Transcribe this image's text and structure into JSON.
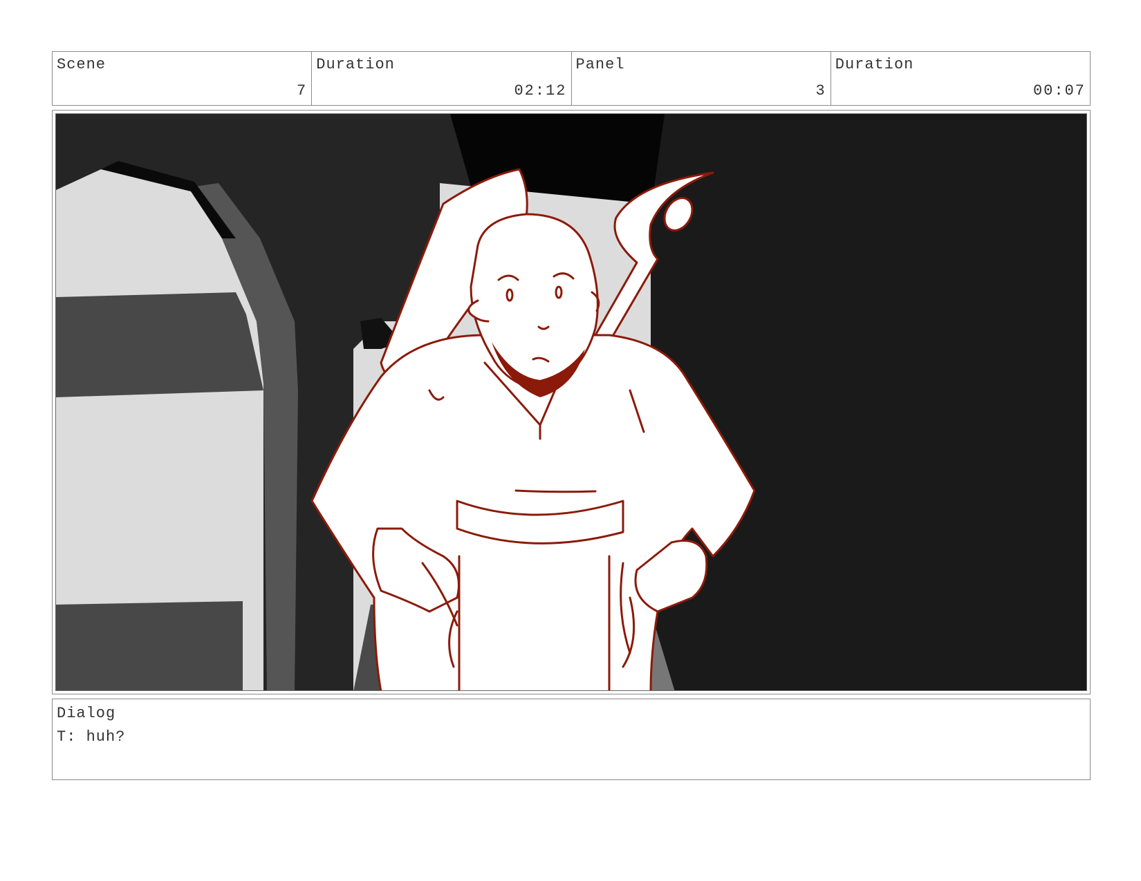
{
  "header": {
    "scene_label": "Scene",
    "scene_value": "7",
    "scene_duration_label": "Duration",
    "scene_duration_value": "02:12",
    "panel_label": "Panel",
    "panel_value": "3",
    "panel_duration_label": "Duration",
    "panel_duration_value": "00:07"
  },
  "panel": {
    "sketch_color": "#8b1a0a",
    "background_color": "#1a1a1a"
  },
  "dialog": {
    "label": "Dialog",
    "text": "T: huh?"
  }
}
